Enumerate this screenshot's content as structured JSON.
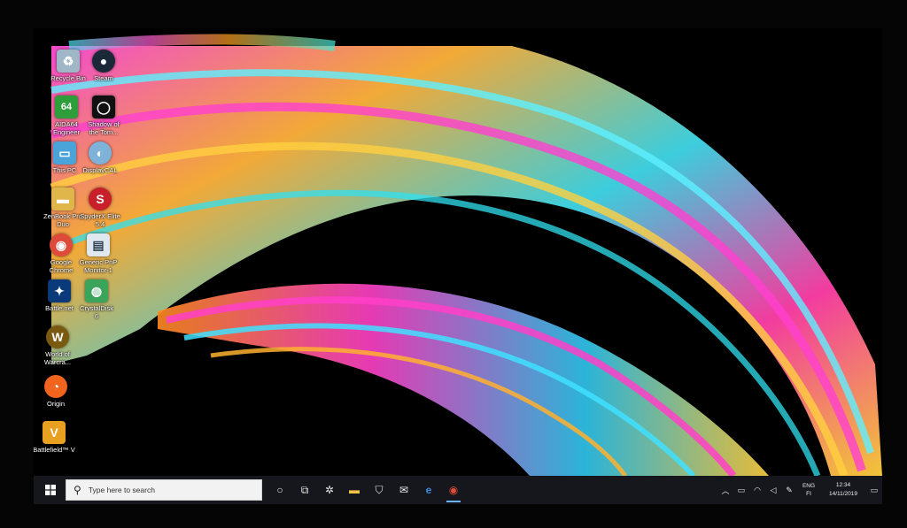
{
  "desktop": {
    "icons": [
      {
        "label": "Recycle Bin",
        "icon": "recycle-bin-icon",
        "symbol": "♻",
        "color": "#9fb7c7"
      },
      {
        "label": "Steam",
        "icon": "steam-icon",
        "symbol": "●",
        "color": "#1b2838"
      },
      {
        "label": "AIDA64\nEngineer",
        "icon": "aida64-icon",
        "symbol": "64",
        "color": "#2e9e3a"
      },
      {
        "label": "Shadow of\nthe Tom...",
        "icon": "shadow-tomb-raider-icon",
        "symbol": "◯",
        "color": "#111111"
      },
      {
        "label": "This PC",
        "icon": "this-pc-icon",
        "symbol": "▭",
        "color": "#4aa3d9"
      },
      {
        "label": "DisplayCAL",
        "icon": "displaycal-icon",
        "symbol": "◐",
        "color": "#7fb2d8"
      },
      {
        "label": "ZenBook Pro\nDuo",
        "icon": "folder-icon",
        "symbol": "▬",
        "color": "#e0b54a"
      },
      {
        "label": "SpyderX Elite\n5.4",
        "icon": "spyderx-icon",
        "symbol": "S",
        "color": "#c8202a"
      },
      {
        "label": "Google\nChrome",
        "icon": "chrome-icon",
        "symbol": "◉",
        "color": "#e04a3a"
      },
      {
        "label": "Generic PnP\nMonitor-1",
        "icon": "monitor-profile-icon",
        "symbol": "▤",
        "color": "#dfe8ef"
      },
      {
        "label": "Battle.net",
        "icon": "battlenet-icon",
        "symbol": "✦",
        "color": "#0b3a7a"
      },
      {
        "label": "CrystalDisk\n6",
        "icon": "crystaldisk-icon",
        "symbol": "◍",
        "color": "#3aa45a"
      },
      {
        "label": "World of\nWarcra...",
        "icon": "world-of-warcraft-icon",
        "symbol": "W",
        "color": "#7a5a10"
      },
      {
        "label": "Origin",
        "icon": "origin-icon",
        "symbol": "◔",
        "color": "#f0641e"
      },
      {
        "label": "Battlefield™ V",
        "icon": "battlefield-icon",
        "symbol": "V",
        "color": "#e8a020"
      }
    ]
  },
  "taskbar": {
    "search_placeholder": "Type here to search",
    "apps": [
      {
        "name": "cortana-icon",
        "symbol": "○",
        "active": false
      },
      {
        "name": "task-view-icon",
        "symbol": "⧉",
        "active": false
      },
      {
        "name": "settings-app-icon",
        "symbol": "✲",
        "active": false
      },
      {
        "name": "file-explorer-icon",
        "symbol": "▬",
        "active": false,
        "color": "#f2c14b"
      },
      {
        "name": "store-icon",
        "symbol": "🛍",
        "active": false
      },
      {
        "name": "mail-icon",
        "symbol": "✉",
        "active": false
      },
      {
        "name": "edge-icon",
        "symbol": "e",
        "active": false,
        "color": "#3c8de0"
      },
      {
        "name": "chrome-taskbar-icon",
        "symbol": "◉",
        "active": true,
        "color": "#e04a3a"
      }
    ],
    "tray": {
      "lang_line1": "ENG",
      "lang_line2": "FI",
      "time": "12:34",
      "date": "14/11/2019"
    }
  }
}
